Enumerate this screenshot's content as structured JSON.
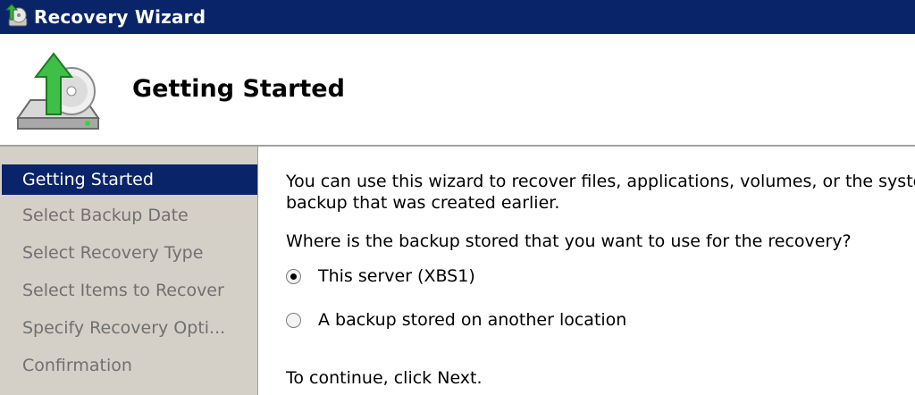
{
  "window": {
    "title": "Recovery Wizard"
  },
  "header": {
    "title": "Getting Started"
  },
  "steps": [
    {
      "label": "Getting Started",
      "active": true
    },
    {
      "label": "Select Backup Date",
      "active": false
    },
    {
      "label": "Select Recovery Type",
      "active": false
    },
    {
      "label": "Select Items to Recover",
      "active": false
    },
    {
      "label": "Specify Recovery Opti...",
      "active": false
    },
    {
      "label": "Confirmation",
      "active": false
    }
  ],
  "content": {
    "intro_line1": "You can use this wizard to recover files, applications, volumes, or the system",
    "intro_line2": "backup that was created earlier.",
    "question": "Where is the backup stored that you want to use for the recovery?",
    "options": [
      {
        "label": "This server (XBS1)",
        "selected": true
      },
      {
        "label": "A backup stored on another location",
        "selected": false
      }
    ],
    "continue": "To continue, click Next."
  },
  "icons": {
    "title": "recovery-wizard-icon",
    "header": "backup-drive-icon"
  },
  "colors": {
    "titlebar": "#0a246a",
    "selection": "#0a246a",
    "panel": "#d4d0c8"
  }
}
